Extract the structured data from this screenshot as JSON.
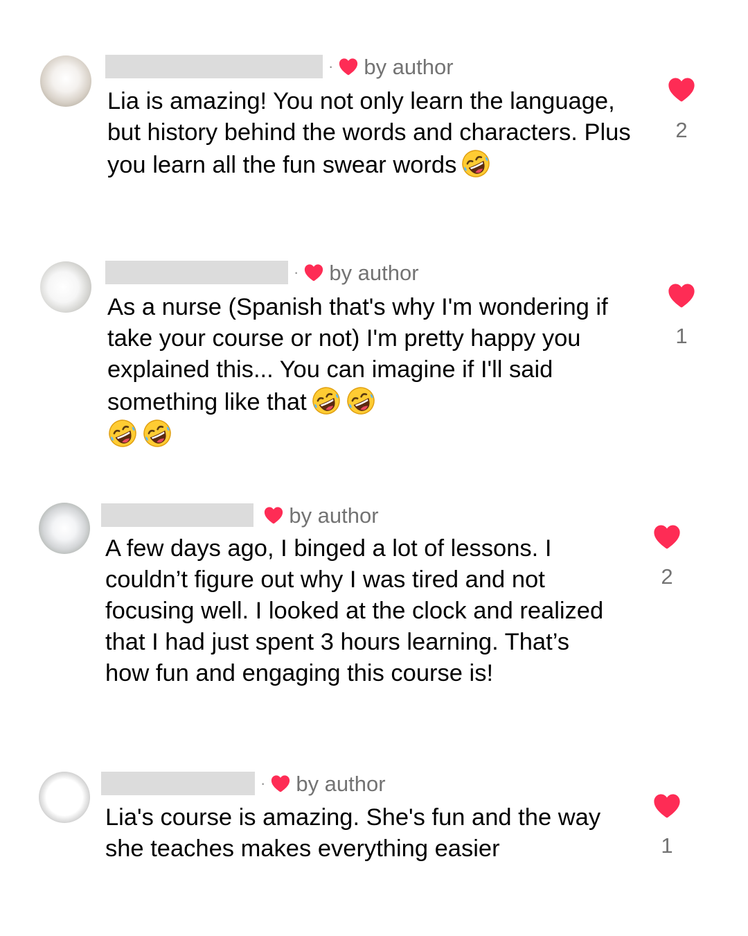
{
  "comments": [
    {
      "badge": "by author",
      "text": "Lia is amazing! You not only learn the language, but history behind the words and characters. Plus you learn all the fun swear words",
      "emoji": [
        "rolling-on-floor-laughing"
      ],
      "likes": "2"
    },
    {
      "badge": "by author",
      "text": "As a nurse (Spanish that's why I'm wondering if take your course or not) I'm pretty happy you explained this... You can imagine if I'll said something like that",
      "emoji": [
        "rolling-on-floor-laughing",
        "rolling-on-floor-laughing",
        "rolling-on-floor-laughing",
        "rolling-on-floor-laughing"
      ],
      "likes": "1"
    },
    {
      "badge": "by author",
      "text": "A few days ago, I binged a lot of lessons. I couldn’t figure out why I was tired and not focusing well. I looked at the clock and realized that I had just spent 3 hours learning. That’s how fun and engaging this course is!",
      "emoji": [],
      "likes": "2"
    },
    {
      "badge": "by author",
      "text": "Lia's course is amazing. She's fun and the way she teaches makes everything easier",
      "emoji": [],
      "likes": "1"
    }
  ],
  "colors": {
    "heart": "#fe2c55",
    "secondary_text": "#737373",
    "redaction": "#dcdcdc"
  },
  "icons": {
    "author_heart": "heart-icon",
    "like_heart": "heart-icon",
    "emoji": "rolling-on-floor-laughing-emoji"
  }
}
